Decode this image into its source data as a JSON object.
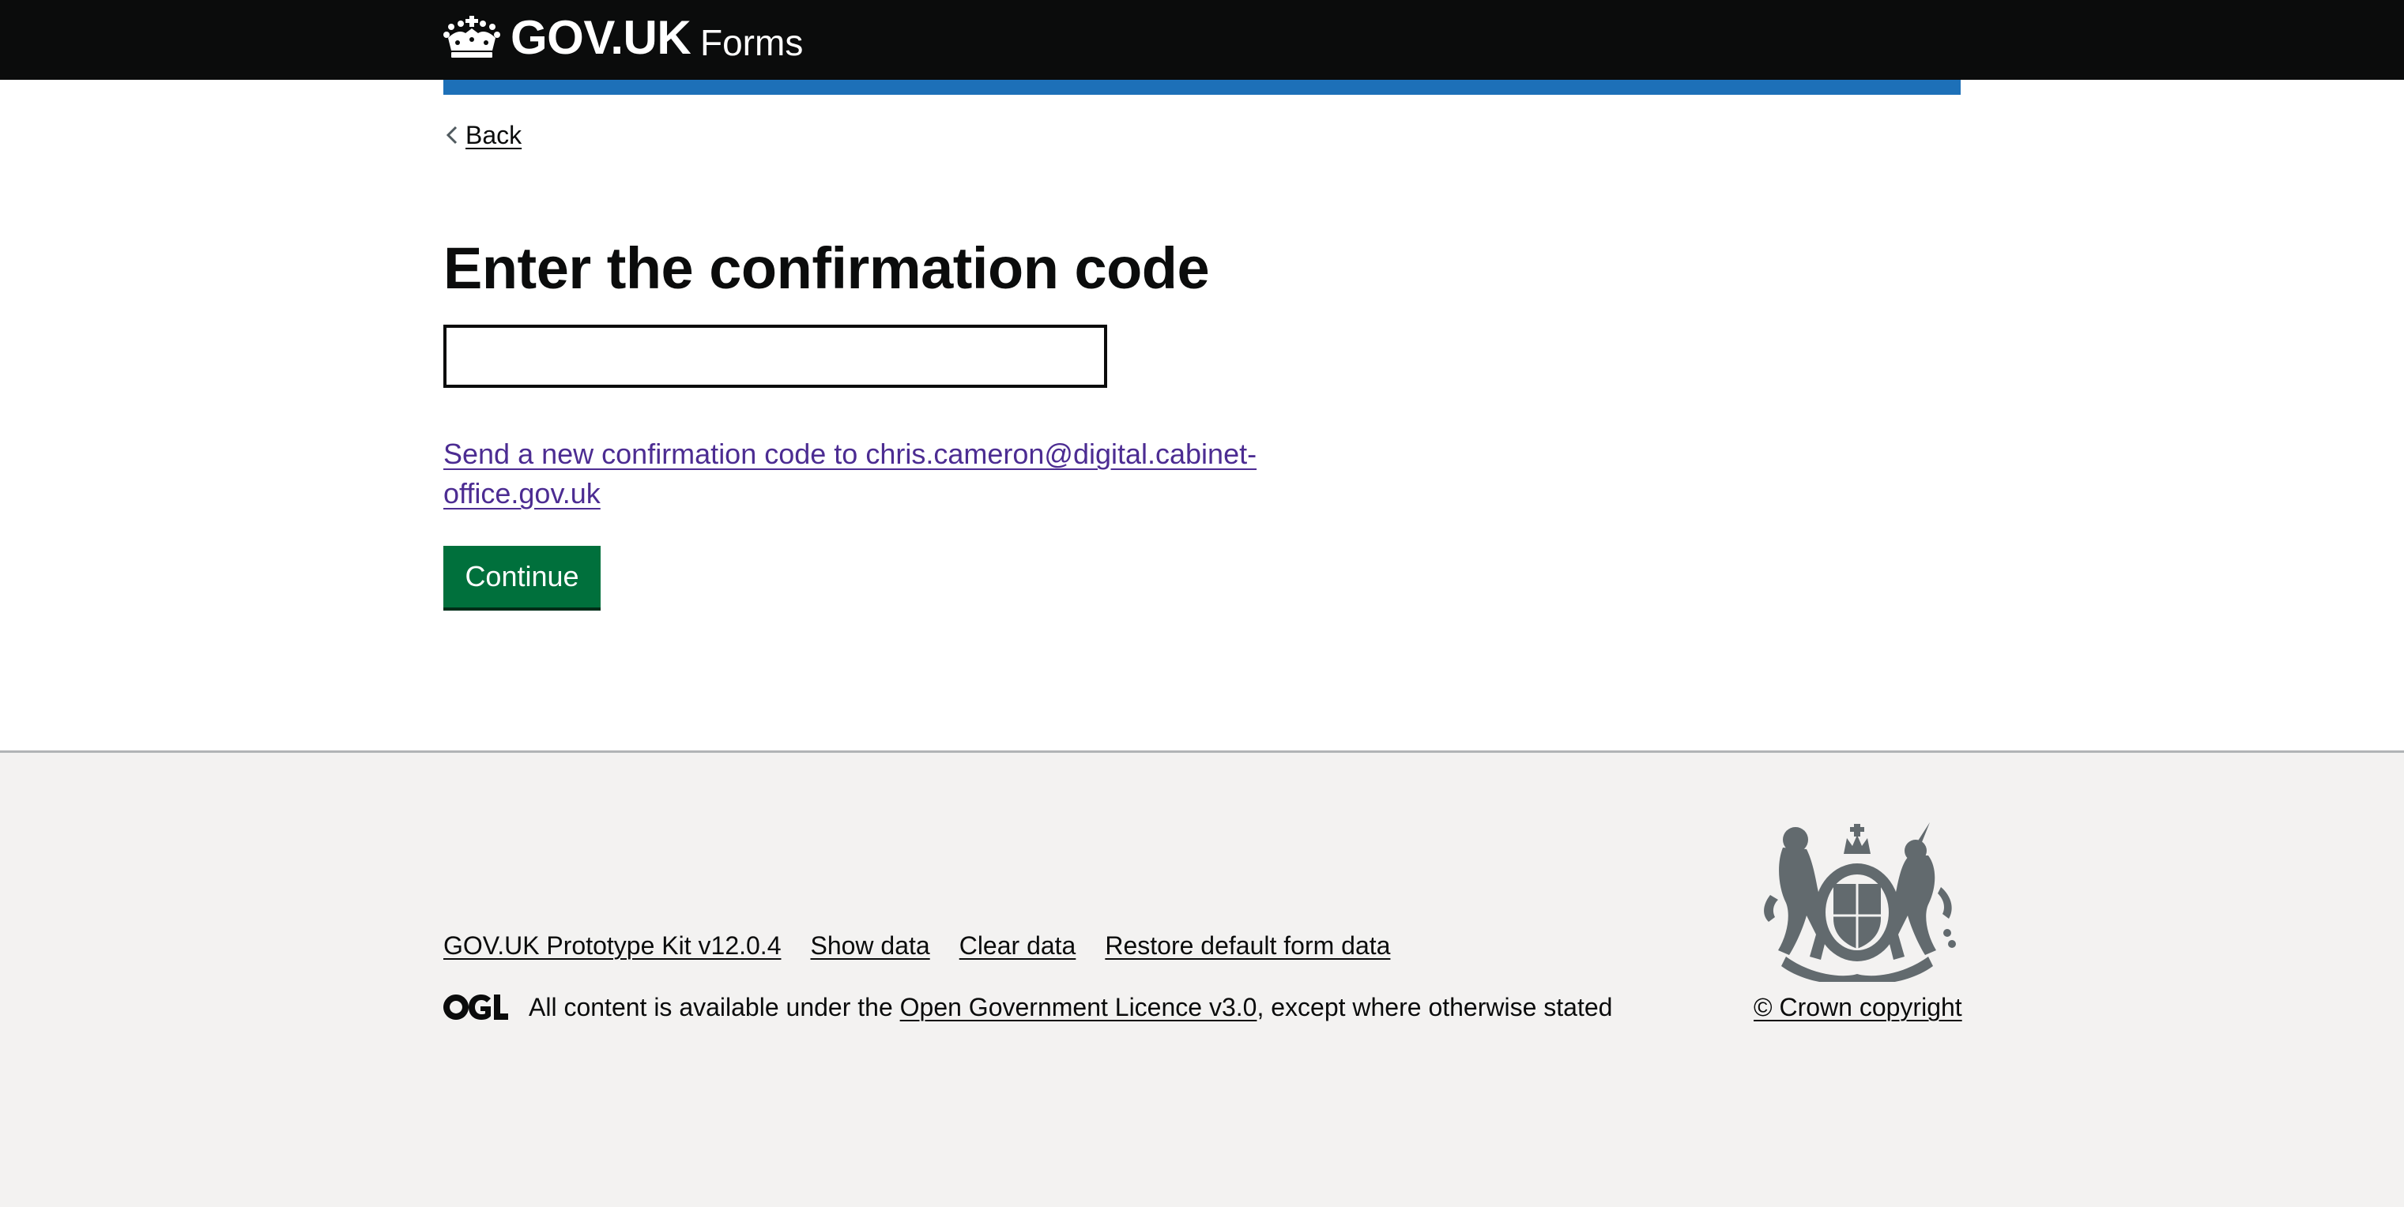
{
  "header": {
    "logo_text": "GOV.UK",
    "service_name": "Forms",
    "crown_icon": "crown-icon"
  },
  "nav": {
    "back_label": "Back",
    "back_icon": "chevron-left-icon"
  },
  "main": {
    "title": "Enter the confirmation code",
    "code_input_value": "",
    "resend_link": "Send a new confirmation code to chris.cameron@digital.cabinet-office.gov.uk",
    "continue_label": "Continue"
  },
  "footer": {
    "links": [
      "GOV.UK Prototype Kit v12.0.4",
      "Show data",
      "Clear data",
      "Restore default form data"
    ],
    "ogl_logo_icon": "ogl-logo",
    "licence_prefix": "All content is available under the ",
    "licence_link": "Open Government Licence v3.0",
    "licence_suffix": ", except where otherwise stated",
    "crest_icon": "royal-coat-of-arms-icon",
    "copyright_label": "© Crown copyright"
  },
  "colors": {
    "header_bg": "#0b0c0c",
    "header_bar": "#1d70b8",
    "button_green": "#00703c",
    "visited_link": "#4c2c92",
    "footer_bg": "#f3f2f1",
    "crest_grey": "#626a6e"
  }
}
